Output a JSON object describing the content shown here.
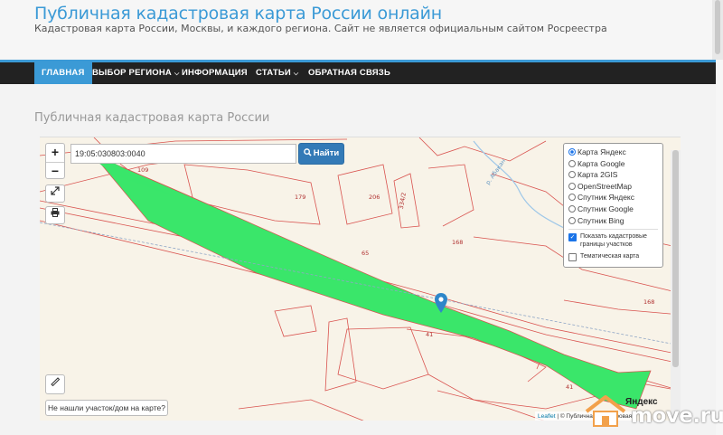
{
  "header": {
    "site_title": "Публичная кадастровая карта России онлайн",
    "site_description": "Кадастровая карта России, Москвы, и каждого региона. Сайт не является официальным сайтом Росреестра"
  },
  "nav": {
    "items": [
      {
        "label": "ГЛАВНАЯ",
        "active": true
      },
      {
        "label": "ВЫБОР РЕГИОНА",
        "has_dropdown": true
      },
      {
        "label": "ИНФОРМАЦИЯ"
      },
      {
        "label": "СТАТЬИ",
        "has_dropdown": true
      },
      {
        "label": "ОБРАТНАЯ СВЯЗЬ"
      }
    ]
  },
  "page": {
    "heading": "Публичная кадастровая карта России"
  },
  "map": {
    "search_value": "19:05:030803:0040",
    "search_button": "Найти",
    "zoom_in": "+",
    "zoom_out": "−",
    "layers": [
      {
        "label": "Карта Яндекс",
        "selected": true
      },
      {
        "label": "Карта Google",
        "selected": false
      },
      {
        "label": "Карта 2GIS",
        "selected": false
      },
      {
        "label": "OpenStreetMap",
        "selected": false
      },
      {
        "label": "Спутник Яндекс",
        "selected": false
      },
      {
        "label": "Спутник Google",
        "selected": false
      },
      {
        "label": "Спутник Bing",
        "selected": false
      }
    ],
    "overlays": [
      {
        "label": "Показать кадастровые границы участков",
        "checked": true
      },
      {
        "label": "Тематическая карта",
        "checked": false
      }
    ],
    "not_found_button": "Не нашли участок/дом на карте?",
    "attribution_leaflet": "Leaflet",
    "attribution_rest": "| © Публичная кадастровая",
    "provider_logo": "Яндекс",
    "parcel_labels": {
      "l109": "109",
      "l179": "179",
      "l206": "206",
      "l3342": "334/2",
      "l65": "65",
      "l168a": "168",
      "l168b": "168",
      "l41a": "41",
      "l41b": "41",
      "river": "р. Абакан"
    },
    "colors": {
      "parcel_fill": "#3ae66a",
      "boundary": "#d9534f",
      "pin": "#2e86c9"
    }
  },
  "watermark": {
    "text": "move.ru"
  }
}
